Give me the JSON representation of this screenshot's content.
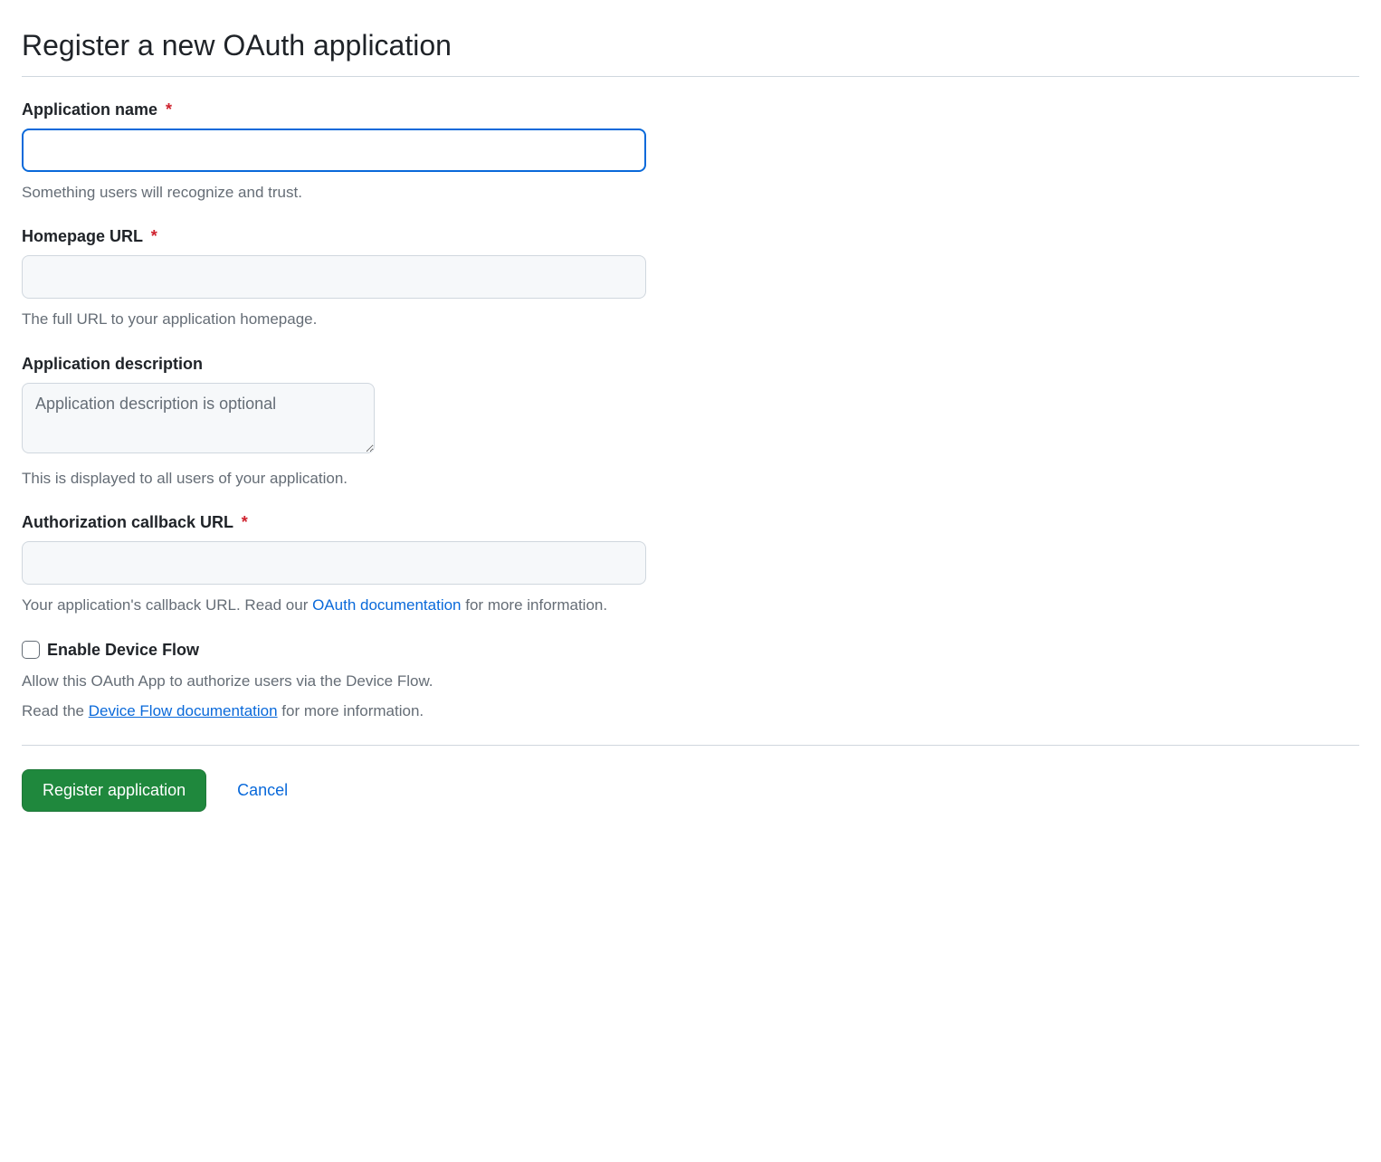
{
  "page": {
    "title": "Register a new OAuth application"
  },
  "fields": {
    "app_name": {
      "label": "Application name",
      "required_mark": "*",
      "value": "",
      "hint": "Something users will recognize and trust."
    },
    "homepage_url": {
      "label": "Homepage URL",
      "required_mark": "*",
      "value": "",
      "hint": "The full URL to your application homepage."
    },
    "description": {
      "label": "Application description",
      "placeholder": "Application description is optional",
      "value": "",
      "hint": "This is displayed to all users of your application."
    },
    "callback_url": {
      "label": "Authorization callback URL",
      "required_mark": "*",
      "value": "",
      "hint_prefix": "Your application's callback URL. Read our ",
      "hint_link_text": "OAuth documentation",
      "hint_suffix": " for more information."
    },
    "device_flow": {
      "label": "Enable Device Flow",
      "hint1": "Allow this OAuth App to authorize users via the Device Flow.",
      "hint2_prefix": "Read the ",
      "hint2_link_text": "Device Flow documentation",
      "hint2_suffix": " for more information."
    }
  },
  "actions": {
    "submit": "Register application",
    "cancel": "Cancel"
  }
}
